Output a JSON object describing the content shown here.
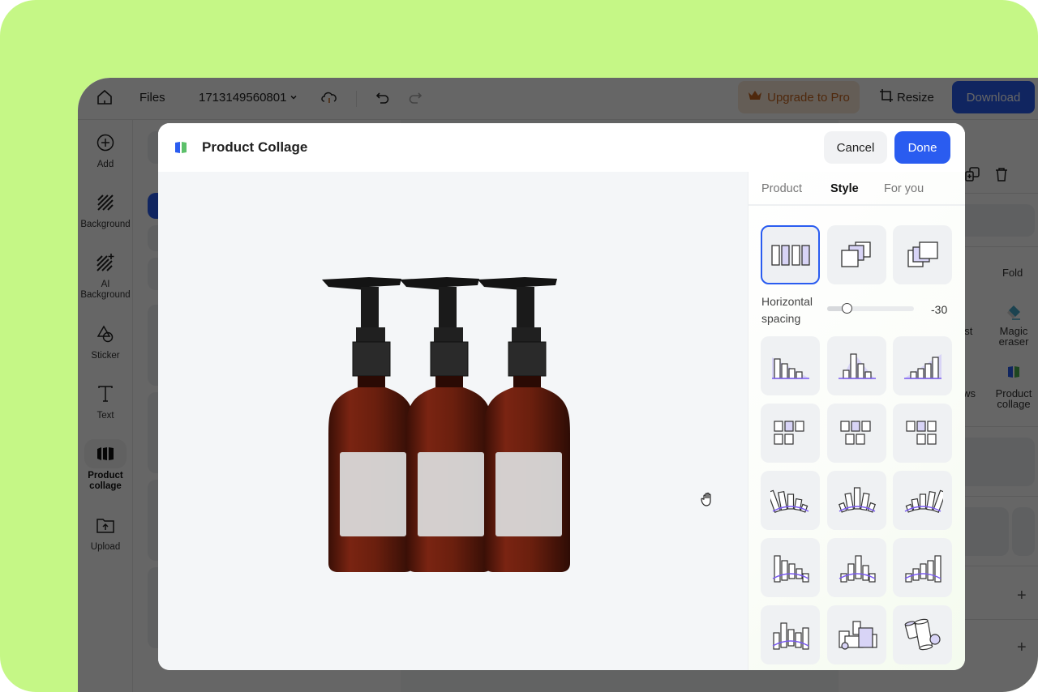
{
  "topbar": {
    "files_label": "Files",
    "document_name": "1713149560801",
    "upgrade_label": "Upgrade to Pro",
    "resize_label": "Resize",
    "download_label": "Download"
  },
  "sidebar": {
    "items": [
      {
        "label": "Add",
        "icon": "plus-circle-icon"
      },
      {
        "label": "Background",
        "icon": "hatch-icon"
      },
      {
        "label": "AI Background",
        "icon": "ai-hatch-icon"
      },
      {
        "label": "Sticker",
        "icon": "shapes-icon"
      },
      {
        "label": "Text",
        "icon": "text-icon"
      },
      {
        "label": "Product collage",
        "icon": "collage-icon",
        "active": true
      },
      {
        "label": "Upload",
        "icon": "upload-folder-icon"
      }
    ]
  },
  "right_panel": {
    "fold_label": "Fold",
    "tools": [
      {
        "label": "ust",
        "icon": "adjust-icon"
      },
      {
        "label": "Magic eraser",
        "icon": "eraser-icon"
      },
      {
        "label": "lows",
        "icon": "shadows-icon"
      },
      {
        "label": "Product collage",
        "icon": "collage-icon"
      }
    ]
  },
  "modal": {
    "title": "Product Collage",
    "cancel_label": "Cancel",
    "done_label": "Done",
    "tabs": [
      {
        "label": "Product",
        "active": false
      },
      {
        "label": "Style",
        "active": true
      },
      {
        "label": "For you",
        "active": false
      }
    ],
    "spacing": {
      "label_line1": "Horizontal",
      "label_line2": "spacing",
      "value": "-30",
      "fraction": 0.22
    },
    "layout_tiles": [
      {
        "name": "side-by-side",
        "selected": true
      },
      {
        "name": "stacked-right",
        "selected": false
      },
      {
        "name": "stacked-left",
        "selected": false
      }
    ],
    "style_tiles": [
      "descending-bars",
      "peak-center-bars",
      "ascending-bars",
      "grid-left",
      "grid-center",
      "grid-right",
      "arc-fan-descending",
      "arc-fan-peak",
      "arc-fan-ascending",
      "arc-descending",
      "arc-peak",
      "arc-ascending",
      "arc-mixed",
      "boxes-stack",
      "cylinders-scatter"
    ],
    "product_count": 3
  },
  "colors": {
    "accent": "#2a5cf0",
    "frame_bg": "#c5f786",
    "upgrade_text": "#c5641e",
    "tile_highlight": "#d5d3f5",
    "arc_purple": "#7a5af0"
  }
}
